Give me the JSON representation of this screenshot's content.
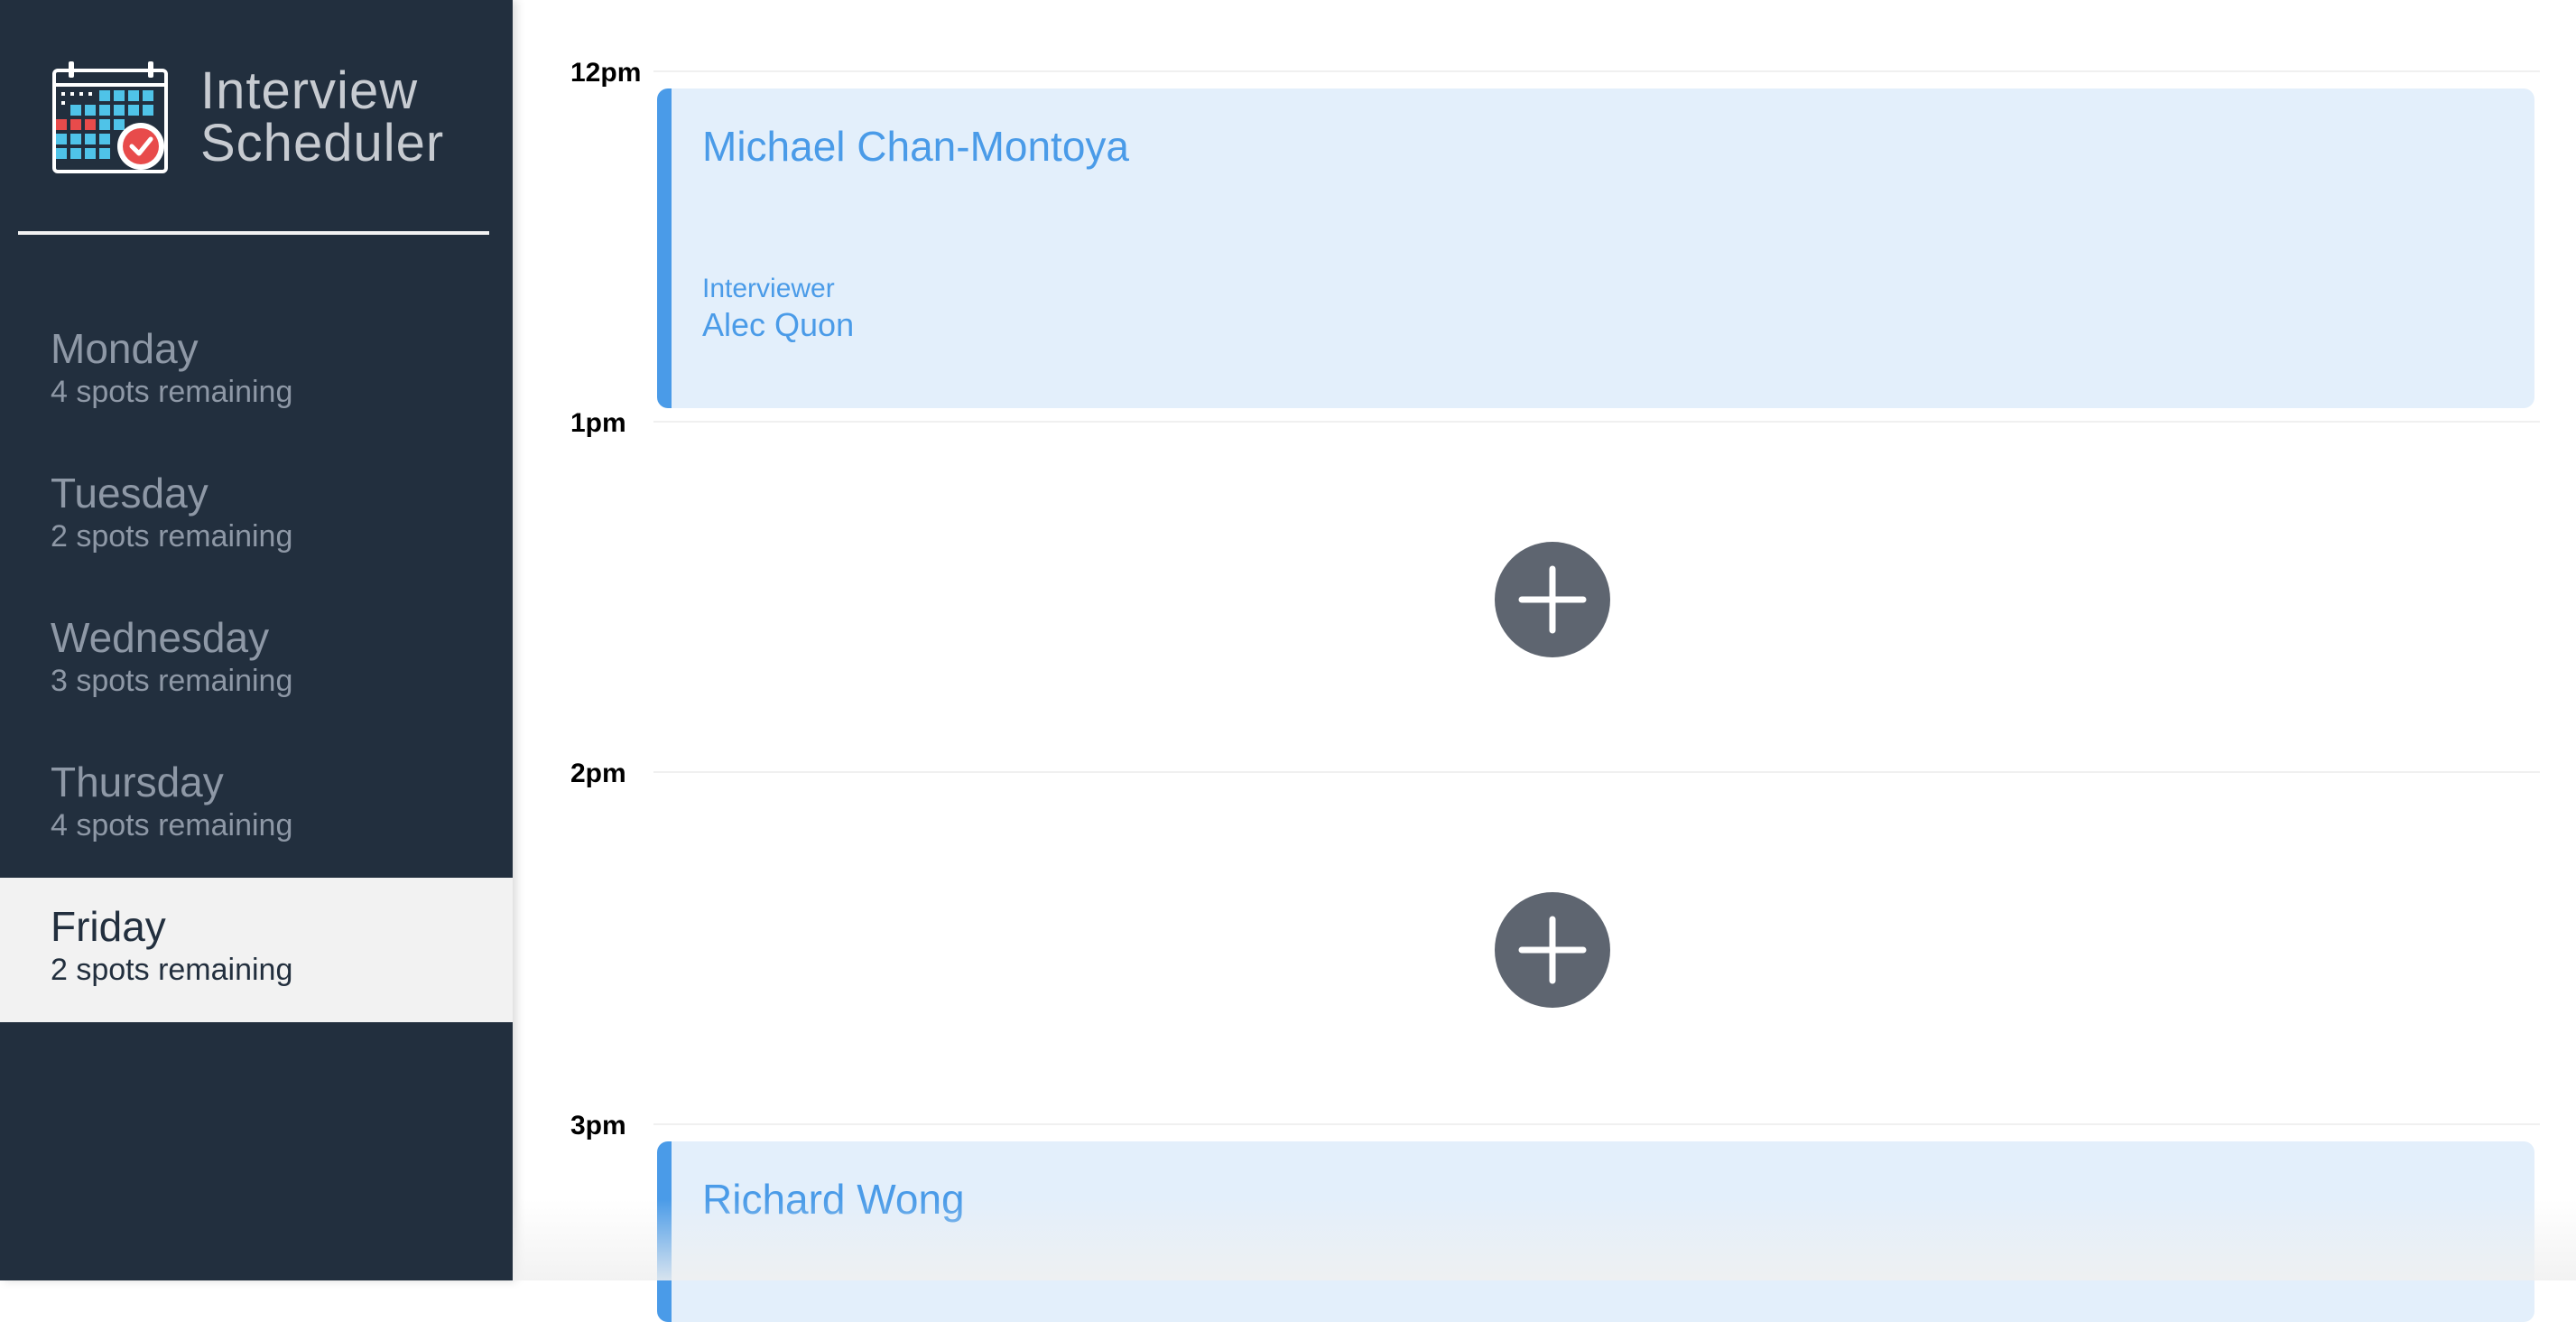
{
  "app": {
    "title_line1": "Interview",
    "title_line2": "Scheduler",
    "logo_icon": "calendar-check-icon"
  },
  "sidebar": {
    "days": [
      {
        "name": "Monday",
        "spots": "4 spots remaining",
        "selected": false
      },
      {
        "name": "Tuesday",
        "spots": "2 spots remaining",
        "selected": false
      },
      {
        "name": "Wednesday",
        "spots": "3 spots remaining",
        "selected": false
      },
      {
        "name": "Thursday",
        "spots": "4 spots remaining",
        "selected": false
      },
      {
        "name": "Friday",
        "spots": "2 spots remaining",
        "selected": true
      }
    ]
  },
  "schedule": {
    "times": [
      "12pm",
      "1pm",
      "2pm",
      "3pm"
    ],
    "appointments": [
      {
        "student": "Michael Chan-Montoya",
        "interviewer_label": "Interviewer",
        "interviewer": "Alec Quon"
      },
      {
        "student": "Richard Wong"
      }
    ],
    "add_icon": "plus-icon"
  },
  "colors": {
    "sidebar_bg": "#222f3e",
    "selected_bg": "#f2f2f2",
    "accent": "#4a9be8",
    "appointment_bg": "#e3effb",
    "add_button": "#5e6570"
  }
}
